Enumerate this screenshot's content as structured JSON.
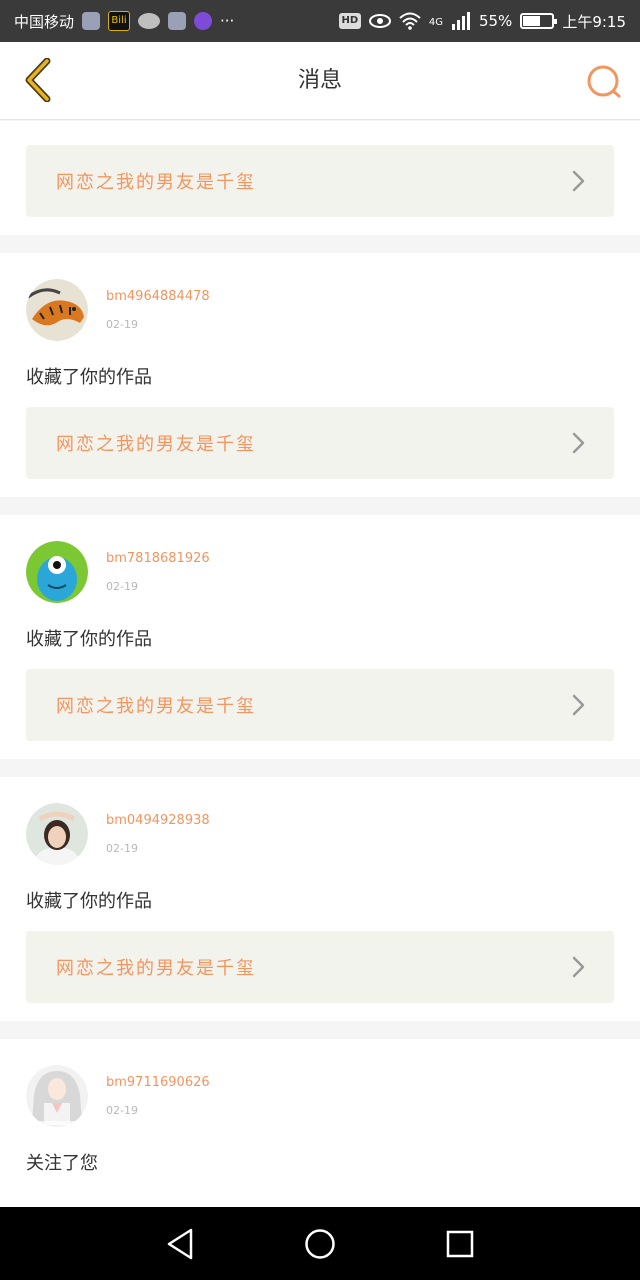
{
  "status_bar": {
    "carrier": "中国移动",
    "bili_label": "Bili",
    "hd_label": "HD",
    "network": "4G",
    "battery_percent": "55%",
    "time": "上午9:15",
    "more": "···"
  },
  "header": {
    "title": "消息"
  },
  "first_card": {
    "work_title": "网恋之我的男友是千玺"
  },
  "notifications": [
    {
      "username": "bm4964884478",
      "date": "02-19",
      "action": "收藏了你的作品",
      "work_title": "网恋之我的男友是千玺"
    },
    {
      "username": "bm7818681926",
      "date": "02-19",
      "action": "收藏了你的作品",
      "work_title": "网恋之我的男友是千玺"
    },
    {
      "username": "bm0494928938",
      "date": "02-19",
      "action": "收藏了你的作品",
      "work_title": "网恋之我的男友是千玺"
    },
    {
      "username": "bm9711690626",
      "date": "02-19",
      "action": "关注了您"
    }
  ],
  "colors": {
    "accent": "#f3955f",
    "back_icon": "#e6b422",
    "card_bg": "#f3f3ee"
  }
}
